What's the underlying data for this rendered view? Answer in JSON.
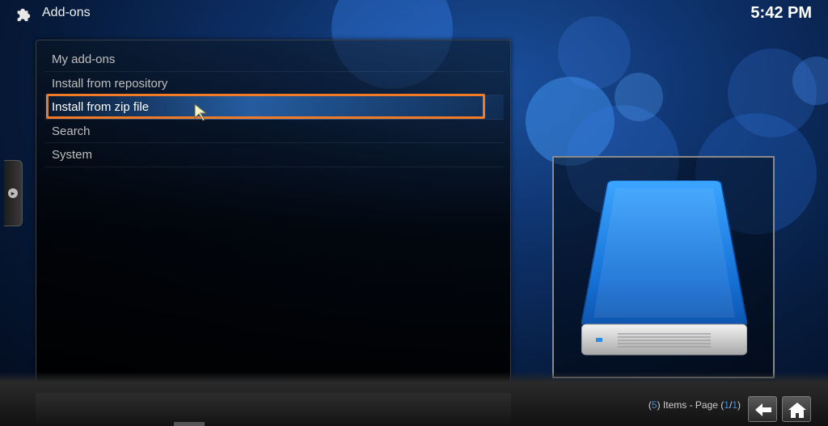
{
  "header": {
    "title": "Add-ons",
    "icon": "puzzle-piece-icon",
    "clock": "5:42 PM"
  },
  "menu": {
    "items": [
      {
        "label": "My add-ons"
      },
      {
        "label": "Install from repository"
      },
      {
        "label": "Install from zip file"
      },
      {
        "label": "Search"
      },
      {
        "label": "System"
      }
    ],
    "selected_index": 2
  },
  "preview": {
    "icon": "hard-drive-icon"
  },
  "footer": {
    "item_count": "5",
    "items_label": "Items - Page",
    "page_current": "1",
    "page_total": "1",
    "back_icon": "back-arrow-icon",
    "home_icon": "home-icon"
  },
  "colors": {
    "highlight": "#f07a26",
    "accent": "#3a8fe8"
  }
}
